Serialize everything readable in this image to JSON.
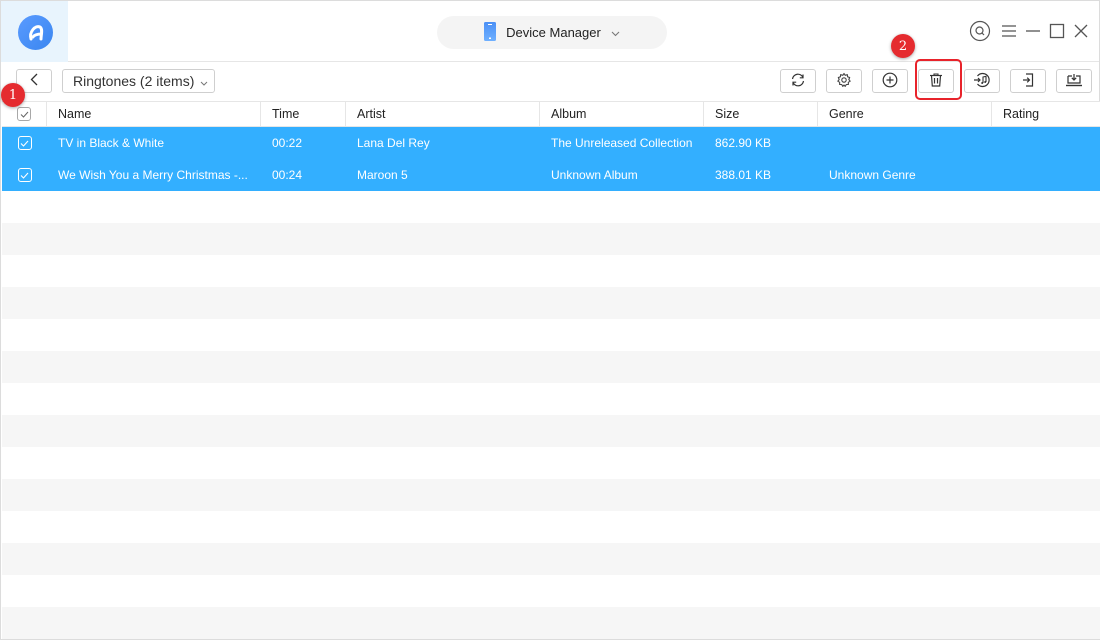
{
  "app": {
    "logo": "airdroid-logo-icon",
    "title_selector": {
      "label": "Device Manager",
      "icon": "phone-icon"
    },
    "window_controls": [
      "search-icon",
      "menu-icon",
      "minimize-icon",
      "maximize-icon",
      "close-icon"
    ]
  },
  "toolbar": {
    "back_icon": "chevron-left-icon",
    "category": "Ringtones (2 items)",
    "buttons": [
      {
        "name": "refresh",
        "icon": "refresh-icon"
      },
      {
        "name": "settings",
        "icon": "gear-icon"
      },
      {
        "name": "add",
        "icon": "plus-circle-icon"
      },
      {
        "name": "delete",
        "icon": "trash-icon"
      },
      {
        "name": "to-itunes",
        "icon": "music-import-icon"
      },
      {
        "name": "to-computer",
        "icon": "export-icon"
      },
      {
        "name": "to-device",
        "icon": "download-tray-icon"
      }
    ]
  },
  "annotations": {
    "badge_1": "1",
    "badge_2": "2",
    "highlight_color": "#e8232b"
  },
  "table": {
    "columns": [
      "Name",
      "Time",
      "Artist",
      "Album",
      "Size",
      "Genre",
      "Rating"
    ],
    "rows": [
      {
        "checked": true,
        "name": "TV in Black & White",
        "time": "00:22",
        "artist": "Lana Del Rey",
        "album": "The Unreleased Collection",
        "size": "862.90 KB",
        "genre": "",
        "rating": ""
      },
      {
        "checked": true,
        "name": "We Wish You a Merry Christmas -...",
        "time": "00:24",
        "artist": "Maroon 5",
        "album": "Unknown Album",
        "size": "388.01 KB",
        "genre": "Unknown Genre",
        "rating": ""
      }
    ],
    "selected_color": "#33afff",
    "stripe_color": "#f6f6f6"
  }
}
